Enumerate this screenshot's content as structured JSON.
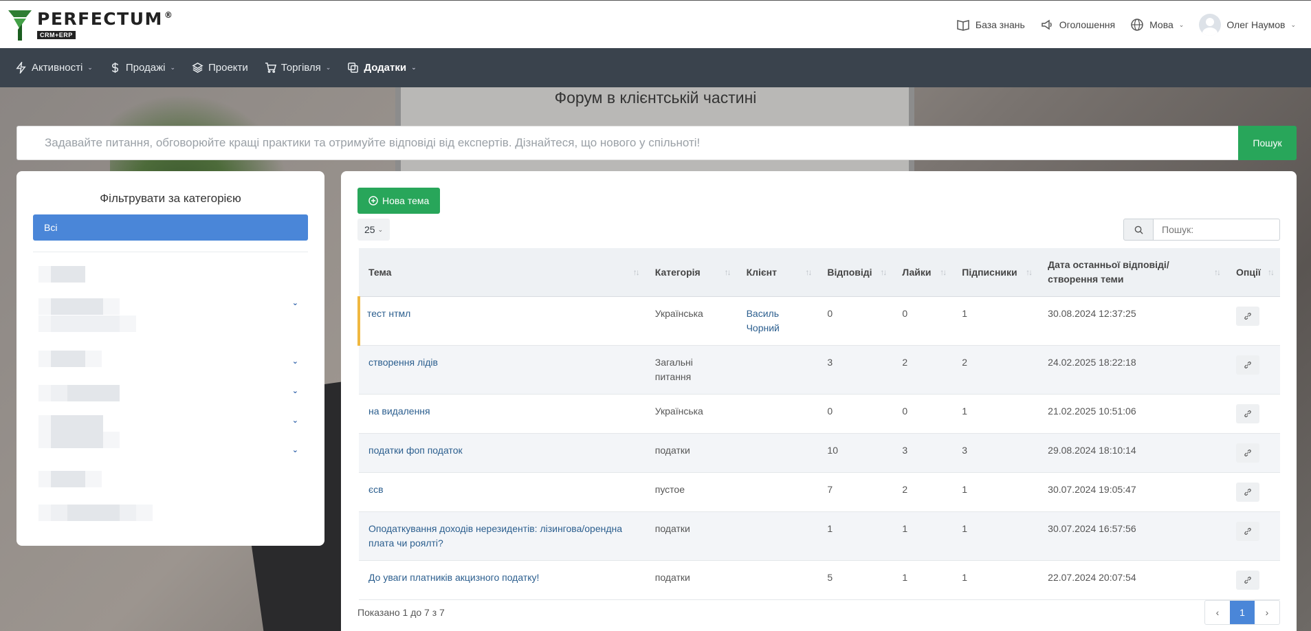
{
  "header": {
    "logo_name": "PERFECTUM",
    "logo_reg": "®",
    "logo_sub": "CRM+ERP",
    "knowledge_base": "База знань",
    "announcements": "Оголошення",
    "language": "Мова",
    "user_name": "Олег Наумов"
  },
  "nav": {
    "items": [
      {
        "label": "Активності"
      },
      {
        "label": "Продажі"
      },
      {
        "label": "Проекти"
      },
      {
        "label": "Торгівля"
      },
      {
        "label": "Додатки"
      }
    ]
  },
  "hero": {
    "title": "Форум в клієнтській частині"
  },
  "forum_search": {
    "placeholder": "Задавайте питання, обговорюйте кращі практики та отримуйте відповіді від експертів. Дізнайтеся, що нового у спільноті!",
    "button": "Пошук"
  },
  "filter": {
    "title": "Фільтрувати за категорією",
    "all_label": "Всі"
  },
  "table_panel": {
    "new_topic_label": "Нова тема",
    "page_size": "25",
    "search_placeholder": "Пошук:",
    "columns": [
      "Тема",
      "Категорія",
      "Клієнт",
      "Відповіді",
      "Лайки",
      "Підписники",
      "Дата останньої відповіді/ створення теми",
      "Опції"
    ],
    "rows": [
      {
        "topic": "тест нтмл",
        "category": "Українська",
        "client": "Василь Чорний",
        "replies": "0",
        "likes": "0",
        "subscribers": "1",
        "date": "30.08.2024 12:37:25"
      },
      {
        "topic": "створення лідів",
        "category": "Загальні питання",
        "client": "",
        "replies": "3",
        "likes": "2",
        "subscribers": "2",
        "date": "24.02.2025 18:22:18"
      },
      {
        "topic": "на видалення",
        "category": "Українська",
        "client": "",
        "replies": "0",
        "likes": "0",
        "subscribers": "1",
        "date": "21.02.2025 10:51:06"
      },
      {
        "topic": "податки фоп податок",
        "category": "податки",
        "client": "",
        "replies": "10",
        "likes": "3",
        "subscribers": "3",
        "date": "29.08.2024 18:10:14"
      },
      {
        "topic": "єсв",
        "category": "пустое",
        "client": "",
        "replies": "7",
        "likes": "2",
        "subscribers": "1",
        "date": "30.07.2024 19:05:47"
      },
      {
        "topic": "Оподаткування доходів нерезидентів: лізингова/орендна плата чи роялті?",
        "category": "податки",
        "client": "",
        "replies": "1",
        "likes": "1",
        "subscribers": "1",
        "date": "30.07.2024 16:57:56"
      },
      {
        "topic": "До уваги платників акцизного податку!",
        "category": "податки",
        "client": "",
        "replies": "5",
        "likes": "1",
        "subscribers": "1",
        "date": "22.07.2024 20:07:54"
      }
    ],
    "showing": "Показано 1 до 7 з 7",
    "current_page": "1",
    "prev": "‹",
    "next": "›"
  },
  "colors": {
    "accent_green": "#28a65a",
    "accent_blue": "#4a86d8",
    "navbar_bg": "#3a434d",
    "link": "#2b5e8e",
    "row_marker": "#f0b840"
  }
}
